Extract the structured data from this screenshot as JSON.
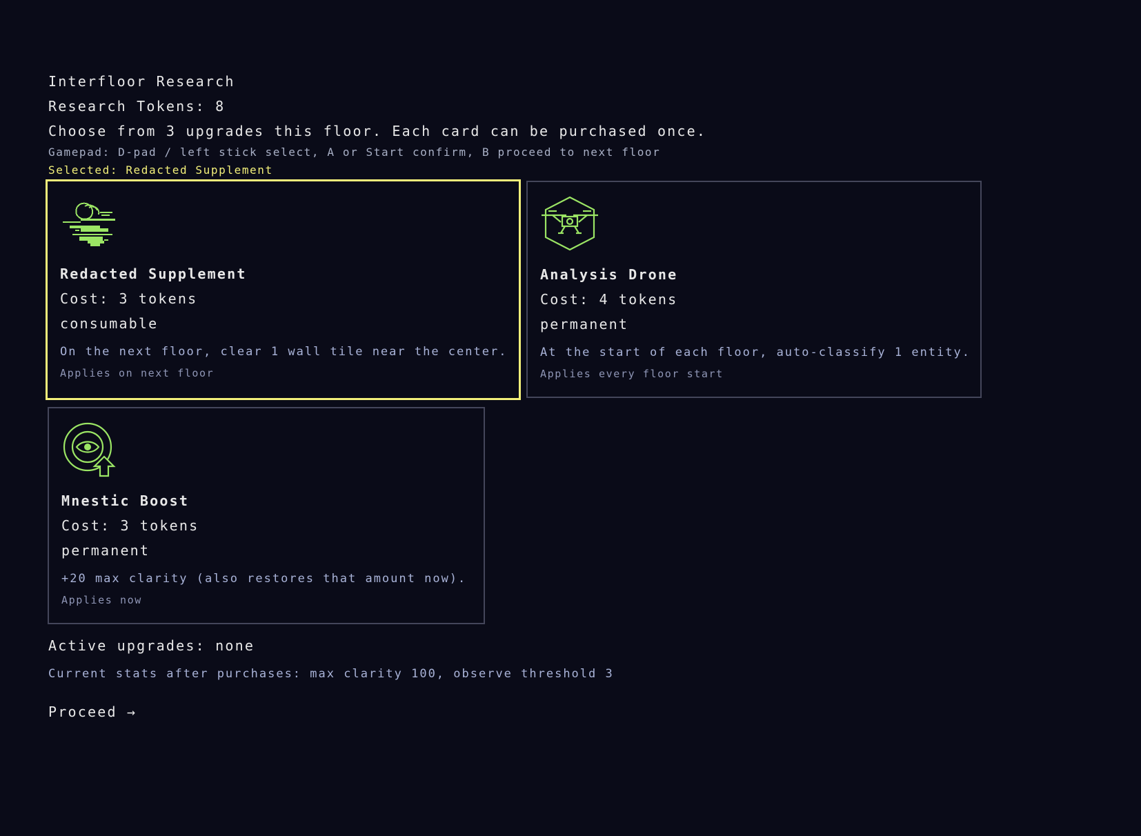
{
  "header": {
    "title": "Interfloor Research",
    "tokens": "Research Tokens: 8",
    "instructions": "Choose from 3 upgrades this floor. Each card can be purchased once.",
    "gamepad": "Gamepad: D-pad / left stick select, A or Start confirm, B proceed to next floor",
    "selected": "Selected: Redacted Supplement"
  },
  "colors": {
    "background": "#0a0b18",
    "accent_selected": "#f3f07a",
    "icon_green": "#9be564",
    "muted_text": "#a9b3d8",
    "card_border": "#44465a"
  },
  "cards": [
    {
      "name": "Redacted Supplement",
      "cost": "Cost: 3 tokens",
      "type": "consumable",
      "description": "On the next floor, clear 1 wall tile near the center.",
      "applies": "Applies on next floor",
      "icon": "redacted-supplement-icon",
      "selected": true
    },
    {
      "name": "Analysis Drone",
      "cost": "Cost: 4 tokens",
      "type": "permanent",
      "description": "At the start of each floor, auto-classify 1 entity.",
      "applies": "Applies every floor start",
      "icon": "drone-icon",
      "selected": false
    },
    {
      "name": "Mnestic Boost",
      "cost": "Cost: 3 tokens",
      "type": "permanent",
      "description": "+20 max clarity (also restores that amount now).",
      "applies": "Applies now",
      "icon": "eye-boost-icon",
      "selected": false
    }
  ],
  "footer": {
    "active": "Active upgrades: none",
    "stats": "Current stats after purchases: max clarity 100, observe threshold 3",
    "proceed": "Proceed →"
  }
}
